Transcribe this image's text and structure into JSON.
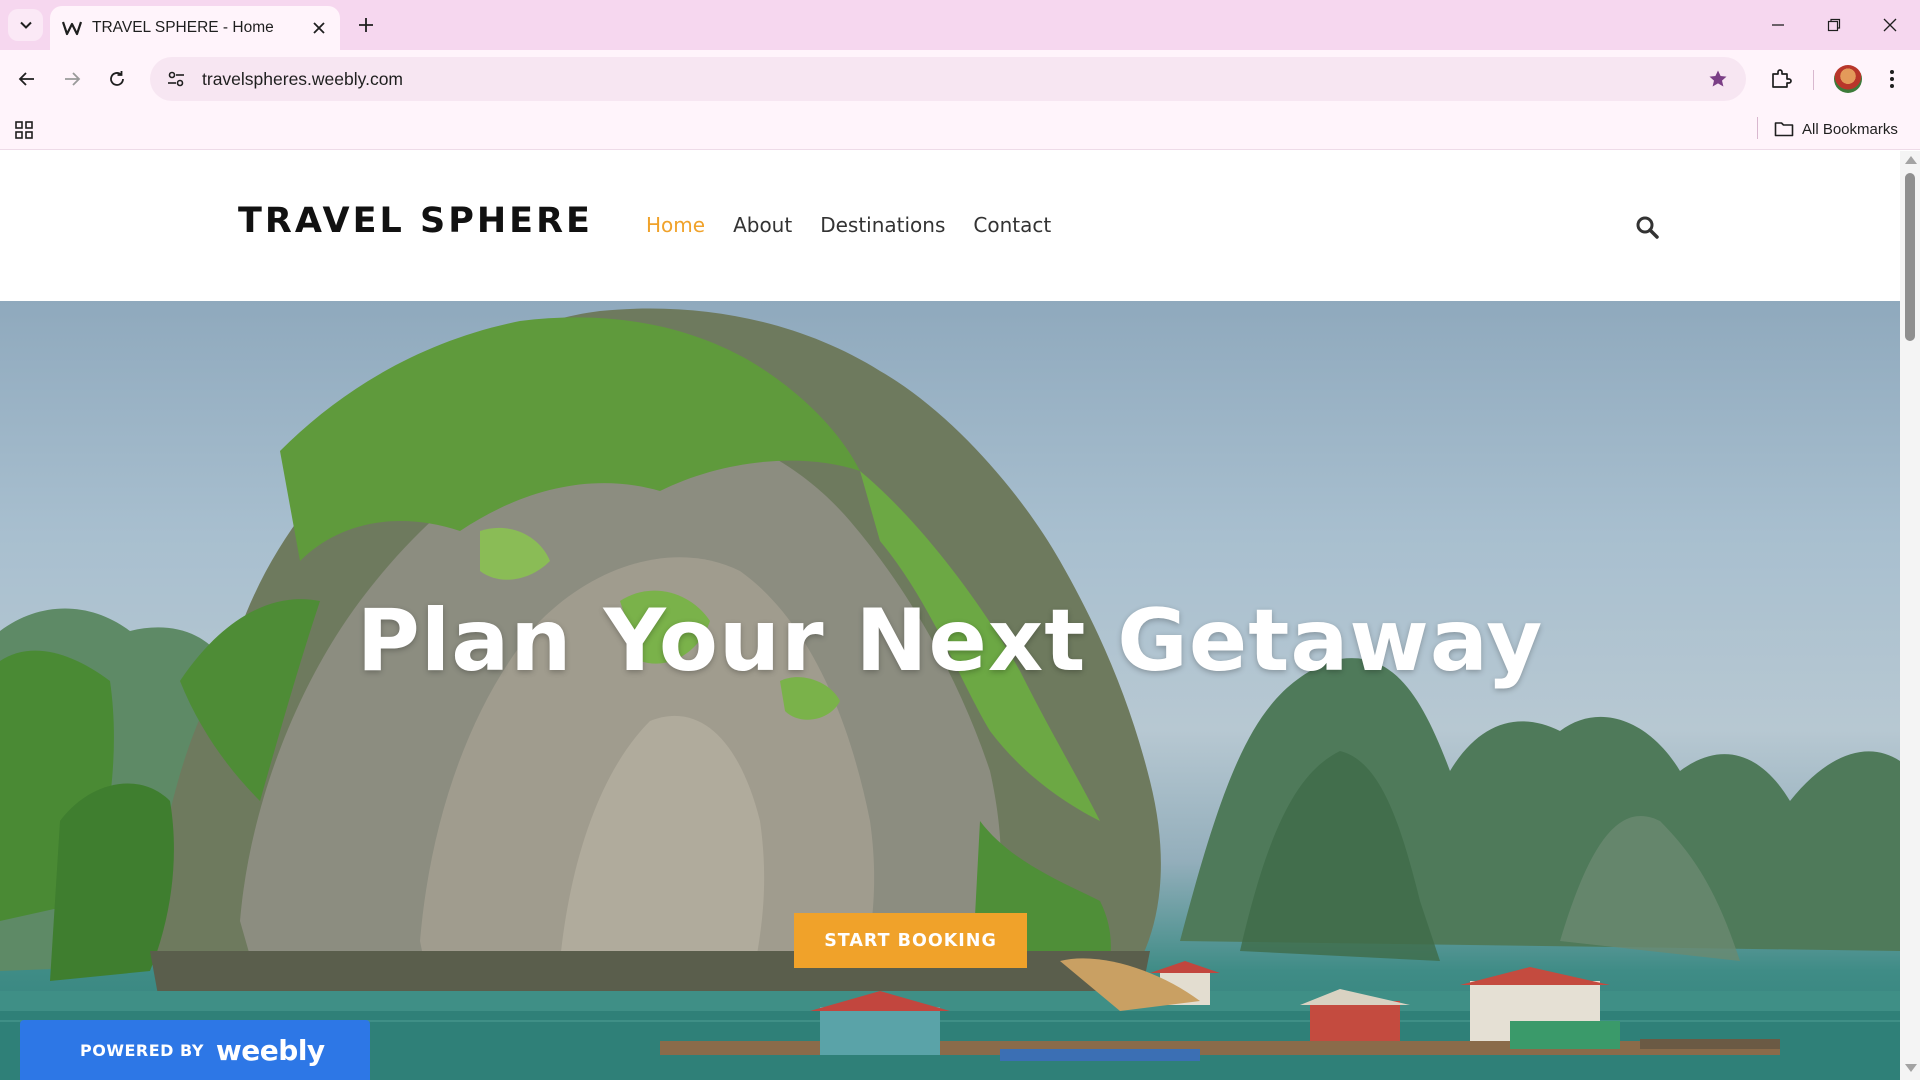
{
  "browser": {
    "tab": {
      "title": "TRAVEL SPHERE - Home",
      "favicon": "weebly-w-icon"
    },
    "address": {
      "url": "travelspheres.weebly.com"
    },
    "bookmarks_bar": {
      "all_bookmarks_label": "All Bookmarks"
    },
    "colors": {
      "tabstrip": "#f6d7ef",
      "toolbar": "#fff4fb",
      "star": "#7b3f86"
    }
  },
  "site": {
    "logo": "TRAVEL SPHERE",
    "nav": [
      {
        "label": "Home",
        "active": true
      },
      {
        "label": "About",
        "active": false
      },
      {
        "label": "Destinations",
        "active": false
      },
      {
        "label": "Contact",
        "active": false
      }
    ],
    "hero": {
      "title": "Plan Your Next Getaway",
      "cta_label": "START BOOKING"
    },
    "badge": {
      "prefix": "POWERED BY",
      "brand": "weebly"
    },
    "colors": {
      "accent": "#f0a22a",
      "badge": "#2d77e6"
    }
  }
}
